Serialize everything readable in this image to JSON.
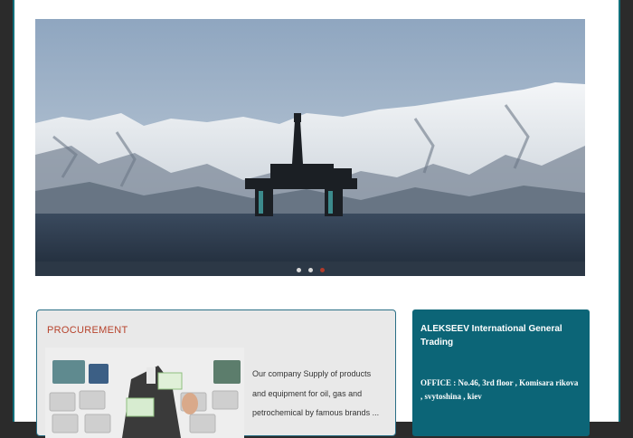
{
  "procurement": {
    "title": "PROCUREMENT",
    "lines": [
      "Our company Supply of products",
      "and equipment for oil, gas and",
      "petrochemical by famous brands ..."
    ]
  },
  "office": {
    "company": "ALEKSEEV International General Trading",
    "address": "OFFICE : No.46, 3rd floor , Komisara rikova , svytoshina , kiev"
  },
  "slider": {
    "slide_count": 3,
    "active_slide": 3
  },
  "colors": {
    "accent": "#0c6577",
    "procurement_title": "#b7432c",
    "active_dot": "#b13a2a"
  }
}
